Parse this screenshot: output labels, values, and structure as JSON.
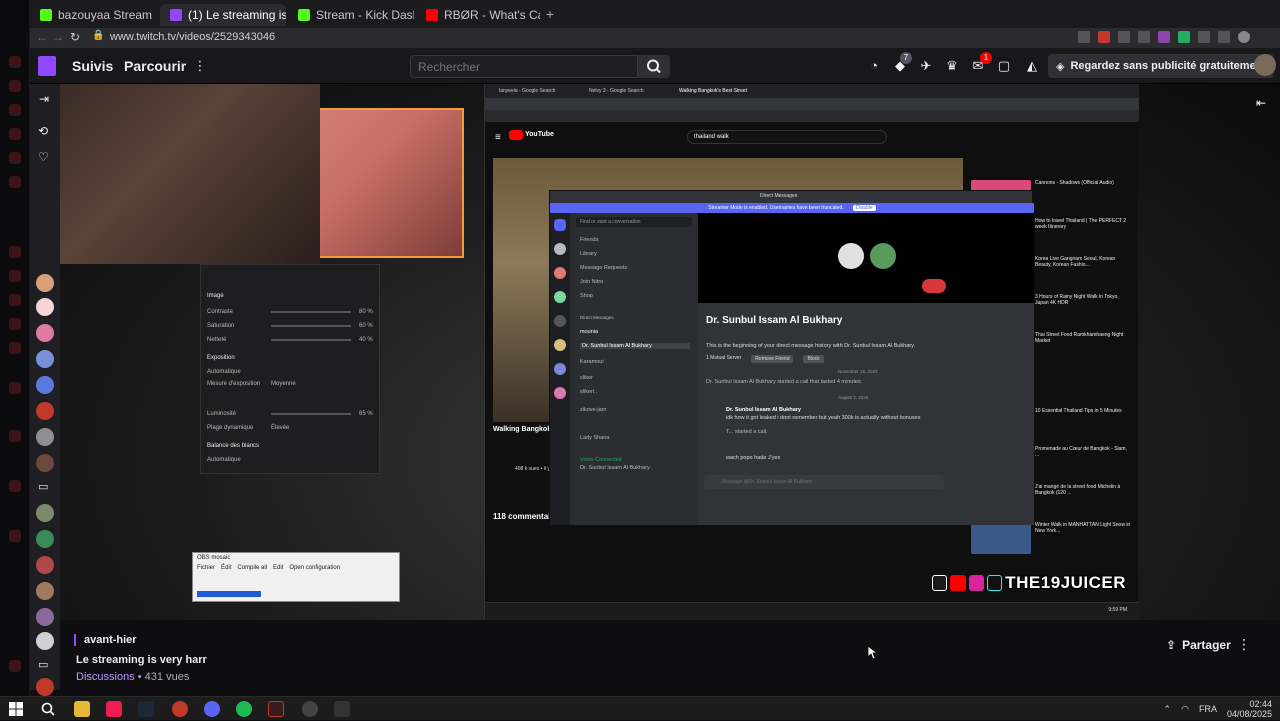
{
  "browser": {
    "tabs": [
      {
        "label": "bazouyaa Stream - Watch",
        "active": false,
        "favicon_color": "#53fc18"
      },
      {
        "label": "(1) Le streaming is ve",
        "active": true,
        "favicon_color": "#9147ff"
      },
      {
        "label": "Stream - Kick Dashboard",
        "active": false,
        "favicon_color": "#53fc18"
      },
      {
        "label": "RBØR - What's Called (P",
        "active": false,
        "favicon_color": "#ff0000"
      }
    ],
    "url": "www.twitch.tv/videos/2529343046"
  },
  "twitch": {
    "nav": {
      "following": "Suivis",
      "browse": "Parcourir",
      "search_placeholder": "Rechercher",
      "promo": "Regardez sans publicité gratuitement",
      "badge_drops": "7",
      "badge_inbox": "1"
    },
    "vod": {
      "date": "avant-hier",
      "title": "Le streaming is very harr",
      "category": "Discussions",
      "separator": "•",
      "views": "431 vues",
      "share": "Partager"
    },
    "overlay_brand": "THE19JUICER"
  },
  "stream_content": {
    "inner_tabs": [
      "lanyeeia - Google Search",
      "Nelvy 3 - Google Search",
      "Walking Bangkok's Best Street"
    ],
    "youtube_search": "thailand walk",
    "youtube_logo": "YouTube",
    "comments_count": "118 commentaires",
    "video_views": "408 k vues • il y a 1 an",
    "video_title": "Walking Bangkok",
    "recs": [
      "Cannons - Shadows (Official Audio)",
      "How to travel Thailand | The PERFECT 2 week Itinerary",
      "Korea Live Gangnam Seoul, Korean Beauty, Korean Fashio...",
      "3 Hours of Rainy Night Walk in Tokyo, Japan 4K HDR",
      "Thai Street Food Ramkhamhaeng Night Market",
      "10 Essential Thailand Tips in 5 Minutes",
      "Promenade au Cœur de Bangkok - Siam, ...",
      "J'ai mangé de la street food Michelin à Bangkok (120 ...",
      "Winter Walk in MANHATTAN Light Snow in New York..."
    ],
    "discord": {
      "window_title": "Direct Messages",
      "banner": "Streamer Mode is enabled. Usernames have been truncated.",
      "banner_action": "Disable",
      "find_placeholder": "Find or start a conversation",
      "nav": [
        "Friends",
        "Library",
        "Message Requests",
        "Join Nitro",
        "Shop"
      ],
      "dm_header": "Direct Messages",
      "dms": [
        "mounia",
        "Dr. Sunbul Issam Al Bukhary",
        "Karamoui",
        "sliker",
        "slikeri..",
        "zikove-jam",
        "Lady Shana"
      ],
      "voice": "Voice Connected",
      "voice_sub": "Dr. Sunbul Issam Al Bukhary",
      "profile_name": "Dr. Sunbul Issam Al Bukhary",
      "intro": "This is the beginning of your direct message history with Dr. Sunbul Issam Al Bukhary.",
      "actions": [
        "1 Mutual Server",
        "Remove Friend",
        "Block"
      ],
      "date1": "November 15, 2023",
      "msg1": "Dr. Sunbul Issam Al Bukhary started a call that lasted 4 minutes.",
      "date2": "August 2, 2025",
      "msg2_author": "Dr. Sunbul Issam Al Bukhary",
      "msg2": "idk how it got leaked i dont remember but yeah 300k is actually without bonuses",
      "msg3": "T... started a call.",
      "msg4": "wach popo hada J'yes",
      "input_placeholder": "Message @Dr. Sunbul Issam Al Bukhary"
    },
    "obs": {
      "section_image": "Image",
      "contraste": "Contraste",
      "saturation": "Saturation",
      "nettete": "Netteté",
      "exposition": "Exposition",
      "automatique": "Automatique",
      "mesure": "Mesure d'exposition",
      "moyenne": "Moyenne",
      "luminosite": "Luminosité",
      "plage": "Plage dynamique",
      "elevee": "Élevée",
      "balance": "Balance des blancs",
      "val_80": "80 %",
      "val_60": "60 %",
      "val_40": "40 %",
      "val_65": "65 %",
      "mini_title": "OBS mosaic",
      "mini_menu": [
        "Fichier",
        "Édit",
        "Compile all",
        "Edit",
        "Open configuration"
      ]
    },
    "inner_time": "9:59 PM"
  },
  "windows": {
    "lang": "FRA",
    "time": "02:44",
    "date": "04/08/2025"
  }
}
